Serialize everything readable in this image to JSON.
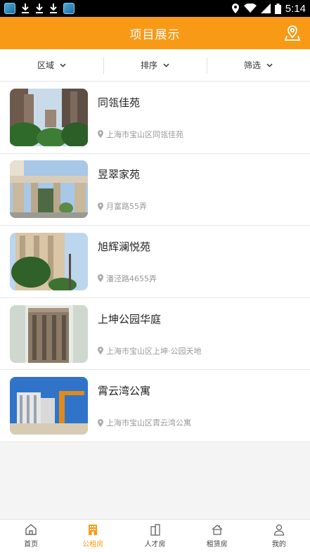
{
  "status_bar": {
    "time": "5:14"
  },
  "header": {
    "title": "项目展示",
    "map_icon": "map-location-icon"
  },
  "filters": [
    {
      "label": "区域"
    },
    {
      "label": "排序"
    },
    {
      "label": "筛选"
    }
  ],
  "projects": [
    {
      "name": "同瓴佳苑",
      "address": "上海市宝山区同瓴佳苑"
    },
    {
      "name": "昱翠家苑",
      "address": "月富路55弄"
    },
    {
      "name": "旭辉澜悦苑",
      "address": "潘泾路4655弄"
    },
    {
      "name": "上坤公园华庭",
      "address": "上海市宝山区上坤·公园天地"
    },
    {
      "name": "霄云湾公寓",
      "address": "上海市宝山区霄云湾公寓"
    }
  ],
  "tabs": [
    {
      "label": "首页",
      "icon": "home-icon"
    },
    {
      "label": "公租房",
      "icon": "building-icon"
    },
    {
      "label": "人才房",
      "icon": "towers-icon"
    },
    {
      "label": "租赁房",
      "icon": "house-icon"
    },
    {
      "label": "我的",
      "icon": "user-icon"
    }
  ],
  "colors": {
    "accent": "#f99a17"
  }
}
